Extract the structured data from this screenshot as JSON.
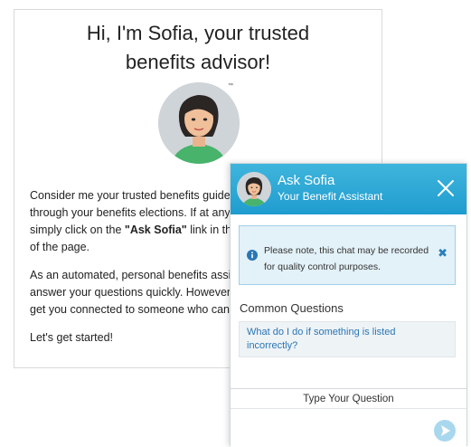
{
  "intro": {
    "title": "Hi, I'm Sofia, your trusted benefits advisor!",
    "trademark": "™",
    "p1_a": "Consider me your trusted benefits guide",
    "p1_b": "through your benefits elections. If at any",
    "p1_c": "simply click on the ",
    "p1_link": "\"Ask Sofia\"",
    "p1_d": " link in the",
    "p1_e": "of the page.",
    "p2_a": "As an automated, personal benefits assi",
    "p2_b": "answer your questions quickly. However",
    "p2_c": "get you connected to someone who can",
    "p3": "Let's get started!"
  },
  "chat": {
    "name": "Ask Sofia",
    "subtitle": "Your Benefit Assistant",
    "notice": "Please note, this chat may be recorded for quality control purposes.",
    "common_questions_heading": "Common Questions",
    "questions": [
      "What do I do if something is listed incorrectly?"
    ],
    "input_label": "Type Your Question"
  },
  "colors": {
    "header": "#2aa6d6",
    "accent": "#2a76b4",
    "notice_bg": "#e3f1f8"
  }
}
